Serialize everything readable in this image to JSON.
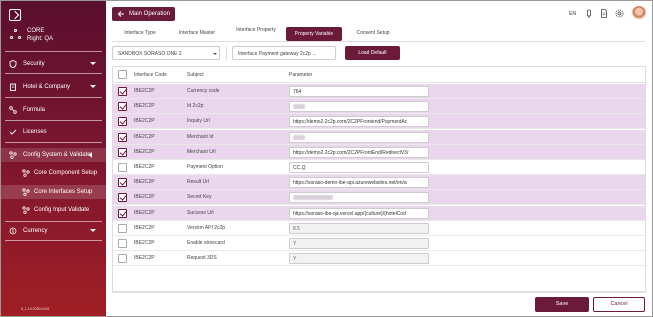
{
  "sidebar": {
    "org_line1": "CORE",
    "org_line2": "Right: QA",
    "items": [
      {
        "label": "Security",
        "icon": "shield-icon"
      },
      {
        "label": "Hotel & Company",
        "icon": "building-icon"
      },
      {
        "label": "Formula",
        "icon": "formula-icon"
      },
      {
        "label": "Licenses",
        "icon": "license-icon"
      },
      {
        "label": "Config System & Validate",
        "icon": "config-icon"
      }
    ],
    "sub_items": [
      {
        "label": "Core Component Setup",
        "icon": "component-icon"
      },
      {
        "label": "Core Interfaces Setup",
        "icon": "interface-icon"
      },
      {
        "label": "Config Input Validate",
        "icon": "validate-icon"
      }
    ],
    "currency": {
      "label": "Currency",
      "icon": "currency-icon"
    },
    "version": "9_1.10.2000.0109"
  },
  "header": {
    "main_operation": "Main Operation",
    "lang": "EN"
  },
  "tabs": [
    {
      "label": "Interface Type"
    },
    {
      "label": "Interface Master"
    },
    {
      "label": "Interface Property"
    },
    {
      "label": "Property Variable"
    },
    {
      "label": "Consent Setup"
    }
  ],
  "filters": {
    "hotel": "SANDBOX SORASO ONE 2",
    "interface": "Interface Payment gateway 2c2p ..."
  },
  "load_default": "Load Default",
  "table": {
    "columns": [
      "Interface Code",
      "Subject",
      "Parameter"
    ],
    "rows": [
      {
        "code": "IBE2C2P",
        "subject": "Currency code",
        "param": "764"
      },
      {
        "code": "IBE2C2P",
        "subject": "Id 2c2p",
        "param": ""
      },
      {
        "code": "IBE2C2P",
        "subject": "Inquiry Url",
        "param": "https://demo2.2c2p.com/2C2PFrontend/PaymentAc"
      },
      {
        "code": "IBE2C2P",
        "subject": "Merchant Id",
        "param": ""
      },
      {
        "code": "IBE2C2P",
        "subject": "Merchant Url",
        "param": "https://demo2.2c2p.com/2C2PFrontEnd/RedirectV3/"
      },
      {
        "code": "IBE2C2P",
        "subject": "Payment Option",
        "param": "CC,Q"
      },
      {
        "code": "IBE2C2P",
        "subject": "Result Url",
        "param": "https://soraso-demo-ibe-api.azurewebsites.net/en/a"
      },
      {
        "code": "IBE2C2P",
        "subject": "Secret Key",
        "param": ""
      },
      {
        "code": "IBE2C2P",
        "subject": "Success Url",
        "param": "https://soraso-ibe-qa.vercel.app/{culture}/{hotelCod"
      },
      {
        "code": "IBE2C2P",
        "subject": "Version API 2c2p",
        "param": "8.5"
      },
      {
        "code": "IBE2C2P",
        "subject": "Enable stroecard",
        "param": "Y"
      },
      {
        "code": "IBE2C2P",
        "subject": "Request 3DS",
        "param": "Y"
      }
    ]
  },
  "footer": {
    "save": "Save",
    "cancel": "Cancel"
  },
  "colors": {
    "accent": "#6b1a3a",
    "row_selected": "#ead7ee"
  }
}
